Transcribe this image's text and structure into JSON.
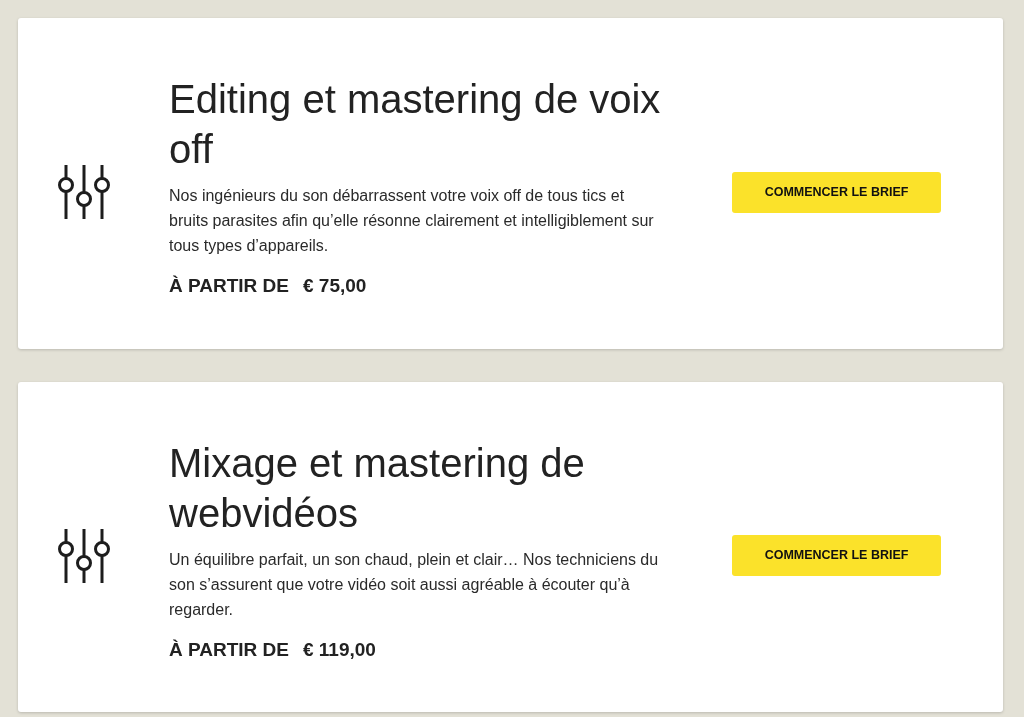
{
  "services": [
    {
      "title": "Editing et mastering de voix off",
      "description": "Nos ingénieurs du son débarrassent votre voix off de tous tics et bruits parasites afin qu’elle résonne clairement et intelligiblement sur tous types d’appareils.",
      "price_label": "À PARTIR DE",
      "price": "€ 75,00",
      "button": "COMMENCER LE BRIEF"
    },
    {
      "title": "Mixage et mastering de webvidéos",
      "description": "Un équilibre parfait, un son chaud, plein et clair… Nos techniciens du son s’assurent que votre vidéo soit aussi agréable à écouter qu’à regarder.",
      "price_label": "À PARTIR DE",
      "price": "€ 119,00",
      "button": "COMMENCER LE BRIEF"
    }
  ]
}
